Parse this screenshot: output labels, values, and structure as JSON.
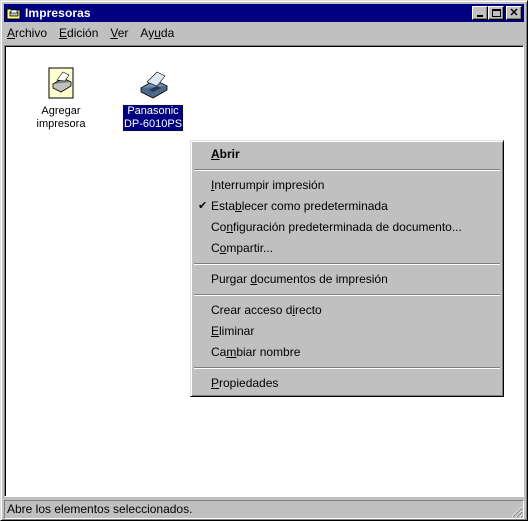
{
  "window": {
    "title": "Impresoras",
    "title_icon": "printers-folder-icon",
    "controls": [
      "minimize",
      "maximize",
      "close"
    ]
  },
  "menubar": {
    "items": [
      {
        "label": "Archivo",
        "accel": "A",
        "rest": "rchivo"
      },
      {
        "label": "Edición",
        "accel": "E",
        "rest": "dición"
      },
      {
        "label": "Ver",
        "accel": "V",
        "rest": "er"
      },
      {
        "label": "Ayuda",
        "pre": "Ay",
        "accel": "u",
        "rest": "da"
      }
    ]
  },
  "icons": [
    {
      "label_line1": "Agregar",
      "label_line2": "impresora",
      "icon": "add-printer-icon",
      "selected": false
    },
    {
      "label_line1": "Panasonic",
      "label_line2": "DP-6010PS",
      "icon": "printer-icon",
      "selected": true
    }
  ],
  "context_menu": {
    "items": [
      {
        "label": "Abrir",
        "pre": "",
        "accel": "A",
        "rest": "brir",
        "default": true
      },
      {
        "separator": true
      },
      {
        "label": "Interrumpir impresión",
        "pre": "",
        "accel": "I",
        "rest": "nterrumpir impresión"
      },
      {
        "label": "Establecer como predeterminada",
        "pre": "Esta",
        "accel": "b",
        "rest": "lecer como predeterminada",
        "checked": true
      },
      {
        "label": "Configuración predeterminada de documento...",
        "pre": "Co",
        "accel": "n",
        "rest": "figuración predeterminada de documento..."
      },
      {
        "label": "Compartir...",
        "pre": "C",
        "accel": "o",
        "rest": "mpartir..."
      },
      {
        "separator": true
      },
      {
        "label": "Purgar documentos de impresión",
        "pre": "Purgar ",
        "accel": "d",
        "rest": "ocumentos de impresión"
      },
      {
        "separator": true
      },
      {
        "label": "Crear acceso directo",
        "pre": "Crear acceso d",
        "accel": "i",
        "rest": "recto"
      },
      {
        "label": "Eliminar",
        "pre": "",
        "accel": "E",
        "rest": "liminar"
      },
      {
        "label": "Cambiar nombre",
        "pre": "Ca",
        "accel": "m",
        "rest": "biar nombre"
      },
      {
        "separator": true
      },
      {
        "label": "Propiedades",
        "pre": "",
        "accel": "P",
        "rest": "ropiedades"
      }
    ],
    "check_glyph": "✔"
  },
  "statusbar": {
    "text": "Abre los elementos seleccionados."
  },
  "colors": {
    "titlebar": "#000080",
    "face": "#c0c0c0",
    "selection": "#000080"
  }
}
